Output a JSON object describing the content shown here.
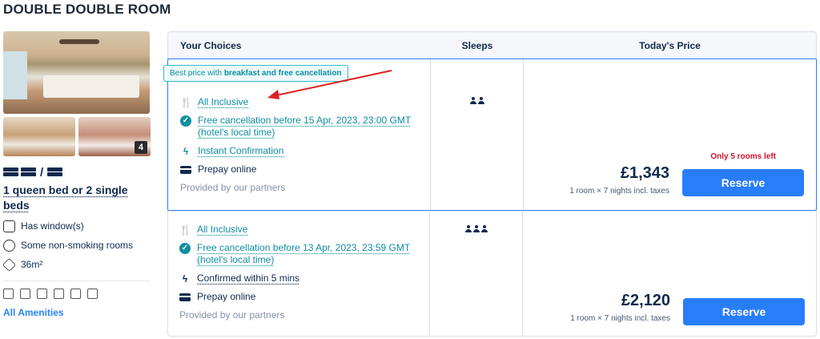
{
  "room": {
    "title": "DOUBLE DOUBLE ROOM",
    "photo_count": "4",
    "bed_separator": "/",
    "bed_text": "1 queen bed or 2 single beds",
    "features": [
      {
        "icon": "window-icon",
        "label": "Has window(s)"
      },
      {
        "icon": "no-smoking-icon",
        "label": "Some non-smoking rooms"
      },
      {
        "icon": "area-icon",
        "label": "36m²"
      }
    ],
    "amenity_icons": [
      "no-wifi-icon",
      "air-conditioner-icon",
      "wardrobe-icon",
      "heater-icon",
      "hair-dryer-icon",
      "desk-icon"
    ],
    "all_amenities": "All Amenities"
  },
  "table": {
    "headers": {
      "choices": "Your Choices",
      "sleeps": "Sleeps",
      "price": "Today's Price"
    }
  },
  "badge": {
    "prefix": "Best price with ",
    "bold": "breakfast and free cancellation"
  },
  "rows": [
    {
      "meal": "All Inclusive",
      "cancellation": "Free cancellation before 15 Apr, 2023, 23:00 GMT (hotel's local time)",
      "confirmation": "Instant Confirmation",
      "payment": "Prepay online",
      "provider": "Provided by our partners",
      "sleeps": 2,
      "rooms_left": "Only 5 rooms left",
      "price": "£1,343",
      "price_note": "1 room × 7 nights incl. taxes",
      "reserve": "Reserve"
    },
    {
      "meal": "All Inclusive",
      "cancellation": "Free cancellation before 13 Apr, 2023, 23:59 GMT (hotel's local time)",
      "confirmation": "Confirmed within 5 mins",
      "payment": "Prepay online",
      "provider": "Provided by our partners",
      "sleeps": 3,
      "price": "£2,120",
      "price_note": "1 room × 7 nights incl. taxes",
      "reserve": "Reserve"
    }
  ],
  "colors": {
    "primary": "#287dfa",
    "teal": "#0f8ea0",
    "urgent": "#d1142c",
    "annotation_arrow": "#e02020"
  }
}
